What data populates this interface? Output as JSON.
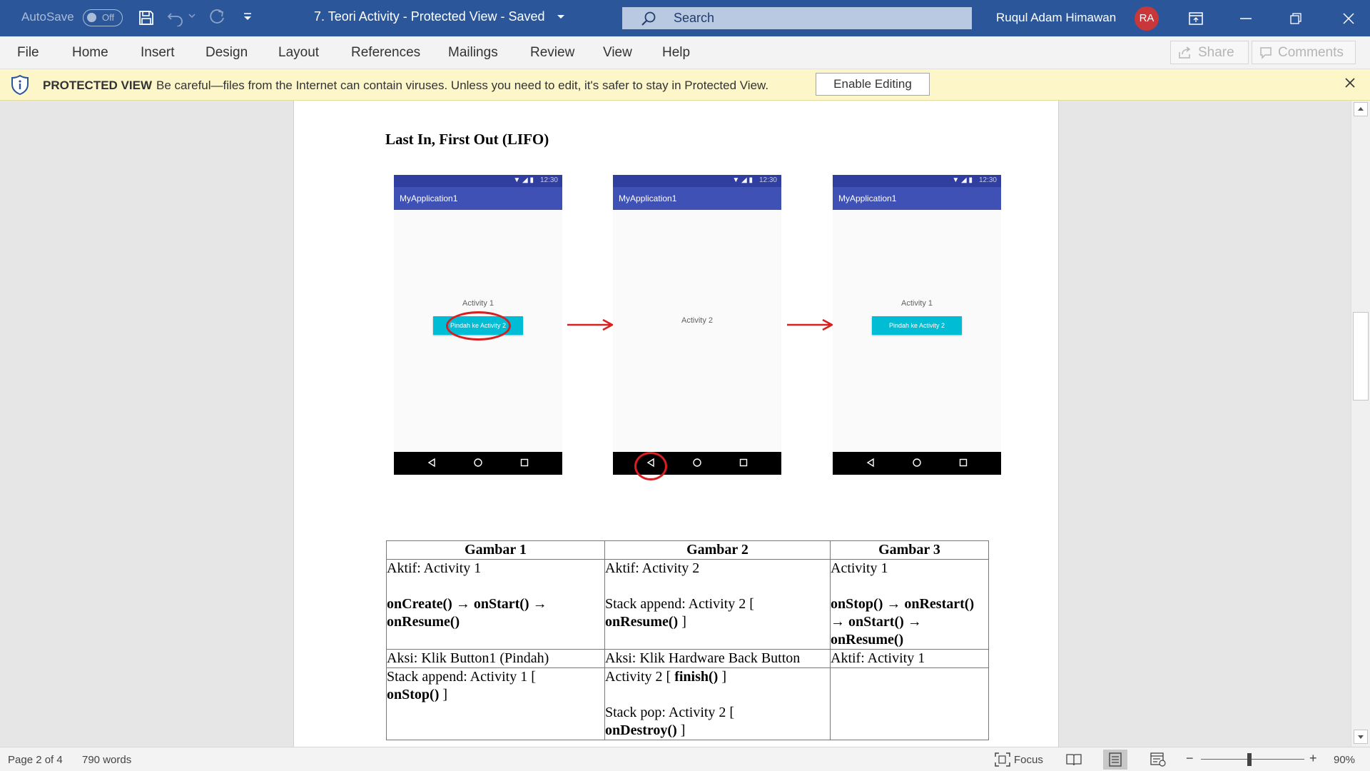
{
  "titlebar": {
    "autosave_label": "AutoSave",
    "autosave_state": "Off",
    "doc_title": "7. Teori Activity  -  Protected View  -  Saved",
    "search_placeholder": "Search",
    "user_name": "Ruqul Adam Himawan",
    "user_initials": "RA",
    "bg_color": "#2b579a"
  },
  "ribbon": {
    "tabs": [
      "File",
      "Home",
      "Insert",
      "Design",
      "Layout",
      "References",
      "Mailings",
      "Review",
      "View",
      "Help"
    ],
    "share_label": "Share",
    "comments_label": "Comments"
  },
  "protected_view": {
    "title": "PROTECTED VIEW",
    "message": "Be careful—files from the Internet can contain viruses. Unless you need to edit, it's safer to stay in Protected View.",
    "enable_label": "Enable Editing",
    "bg_color": "#fdf6c8"
  },
  "document": {
    "heading": "Last In, First Out (LIFO)",
    "phones": [
      {
        "status_time": "12:30",
        "app_title": "MyApplication1",
        "label": "Activity 1",
        "button": "Pindah ke Activity 2"
      },
      {
        "status_time": "12:30",
        "app_title": "MyApplication1",
        "label": "Activity 2",
        "button": ""
      },
      {
        "status_time": "12:30",
        "app_title": "MyApplication1",
        "label": "Activity 1",
        "button": "Pindah ke Activity 2"
      }
    ],
    "table": {
      "headers": [
        "Gambar 1",
        "Gambar 2",
        "Gambar 3"
      ],
      "r1": {
        "c1_l1": "Aktif: Activity 1",
        "c1_b1": "onCreate()",
        "c1_t1": " → ",
        "c1_b2": "onStart()",
        "c1_t2": " →",
        "c1_b3": "onResume()",
        "c2_l1": "Aktif: Activity 2",
        "c2_t1": "Stack append: Activity 2 [",
        "c2_b1": "onResume()",
        "c2_t2": " ]",
        "c3_l1": "Activity 1",
        "c3_b1": "onStop()",
        "c3_t1": " → ",
        "c3_b2": "onRestart()",
        "c3_t2": "→ ",
        "c3_b3": "onStart()",
        "c3_t3": " →",
        "c3_b4": "onResume()"
      },
      "r2": {
        "c1": "Aksi: Klik Button1 (Pindah)",
        "c2": "Aksi: Klik Hardware Back Button",
        "c3": "Aktif: Activity 1"
      },
      "r3": {
        "c1_t1": "Stack append: Activity 1 [",
        "c1_b1": "onStop()",
        "c1_t2": " ]",
        "c2_t1": "Activity 2 [ ",
        "c2_b1": "finish()",
        "c2_t2": " ]",
        "c2_t3": "Stack pop: Activity 2 [",
        "c2_b2": "onDestroy()",
        "c2_t4": " ]",
        "c3": ""
      }
    }
  },
  "statusbar": {
    "page": "Page 2 of 4",
    "words": "790 words",
    "focus_label": "Focus",
    "zoom_minus": "−",
    "zoom_plus": "+",
    "zoom": "90%"
  }
}
